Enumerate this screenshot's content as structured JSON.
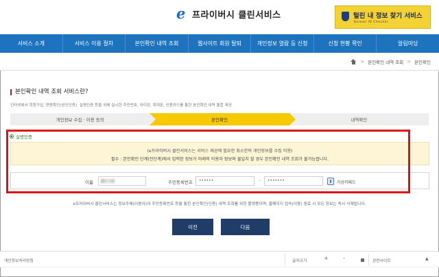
{
  "header": {
    "logo_mark": "e",
    "logo_text": "프라이버시 클린서비스",
    "banner_title": "털린 내 정보 찾기 서비스",
    "banner_sub": "Korean ID Checker"
  },
  "nav": {
    "items": [
      "서비스 소개",
      "서비스 이용 절차",
      "본인확인 내역 조회",
      "웹사이트 회원 탈퇴",
      "개인정보 열람 등 신청",
      "신청 현황 확인",
      "알림마당"
    ]
  },
  "breadcrumb": {
    "items": [
      "본인확인 내역 조회",
      "본인확인"
    ],
    "separator": ">"
  },
  "section": {
    "title": "본인확인 내역 조회 서비스란?",
    "desc": "인터넷에서 회원가입, 연령확인(성인인증), 실명인증 등을 위해 실시한 주민번호, 아이핀, 휴대폰, 신용카드를 통한 본인확인 내역 통합 제공"
  },
  "steps": [
    "개인정보 수집 · 이용 동의",
    "본인확인",
    "내역확인"
  ],
  "auth": {
    "label": "실명인증",
    "notice_line1": "(e프라이버시 클린서비스는 서비스 제공에 필요한 최소한의 개인정보를 수집 이용)",
    "notice_line2": "필수 : 본인확인 단계(전단계)에서 입력한 정보가 아래의 이용자 정보와 불일치 할 경우 본인확인 내역 조회가 불가능합니다."
  },
  "form": {
    "name_label": "이름",
    "rrn_label": "주민등록번호",
    "rrn_front": "••••••",
    "dash": "-",
    "rrn_back": "•••••••",
    "keypad_label": "가상키패드"
  },
  "footnote": "e프라이버시 클린서비스는 정보주체(이용자)의 주민등록번호 등을 통한 본인확인(인증) 내역 조회를 위한 플랫폼이며, 홈페이지 접속(이용) 종료 시 모든 정보는 즉시 삭제됩니다.",
  "buttons": {
    "prev": "이전",
    "next": "다음"
  },
  "footer": {
    "policy": "개인정보처리방침",
    "font_size": "글자크기",
    "plus": "+",
    "minus": "-",
    "related": "관련사이트",
    "caret": "▲"
  }
}
